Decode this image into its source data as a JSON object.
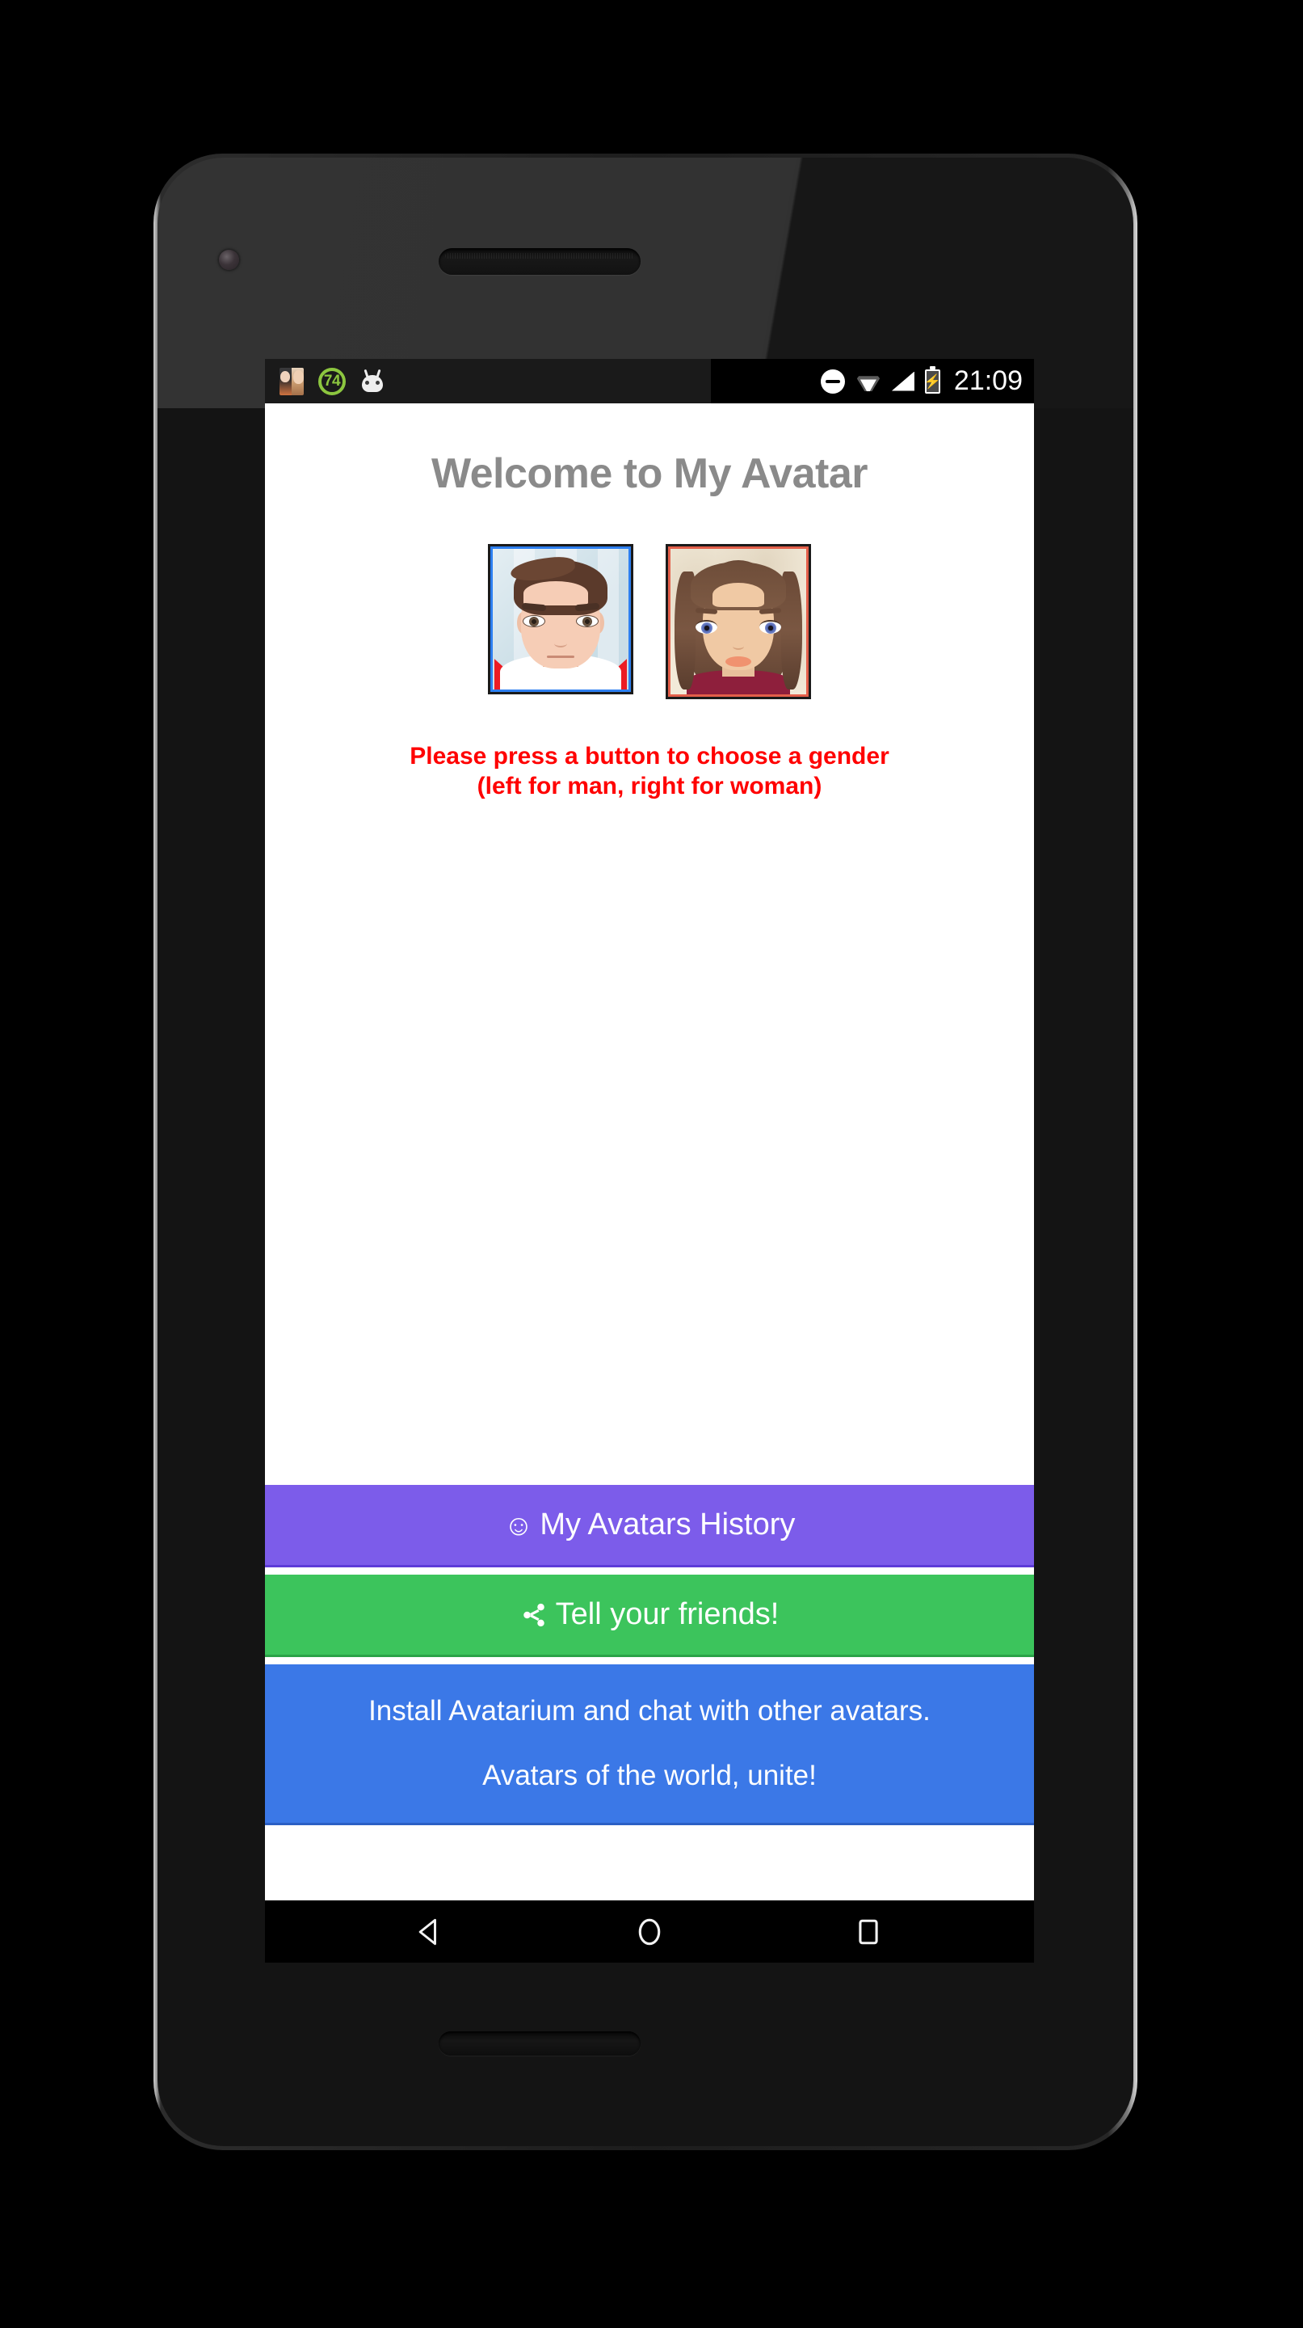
{
  "statusbar": {
    "clock": "21:09",
    "left_icons": [
      {
        "name": "avatar-notification-icon"
      },
      {
        "name": "badge-74-icon",
        "label": "74"
      },
      {
        "name": "android-head-icon"
      }
    ],
    "right_icons": [
      {
        "name": "do-not-disturb-icon"
      },
      {
        "name": "wifi-icon"
      },
      {
        "name": "cellular-signal-icon"
      },
      {
        "name": "battery-charging-icon",
        "glyph": "⚡"
      }
    ]
  },
  "app": {
    "title": "Welcome to My Avatar",
    "title_color": "#8a8a8a",
    "instruction_line1": "Please press a button to choose a gender",
    "instruction_line2": "(left for man, right for woman)",
    "instruction_color": "#ff0000",
    "avatars": [
      {
        "name": "male-avatar",
        "gender": "man",
        "position": "left",
        "border_color": "#2d7ff0"
      },
      {
        "name": "female-avatar",
        "gender": "woman",
        "position": "right",
        "border_color": "#e35f4a"
      }
    ],
    "buttons": {
      "history": {
        "label": "My Avatars History",
        "emoji": "☺",
        "color": "#7c5cea"
      },
      "share": {
        "label": "Tell your friends!",
        "icon": "share-icon",
        "color": "#3cc45c"
      },
      "install_banner": {
        "line1": "Install Avatarium and chat with other avatars.",
        "line2": "Avatars of the world, unite!",
        "color": "#3b78e7"
      }
    }
  },
  "navbar": {
    "back": "back-button",
    "home": "home-button",
    "recents": "recents-button"
  }
}
